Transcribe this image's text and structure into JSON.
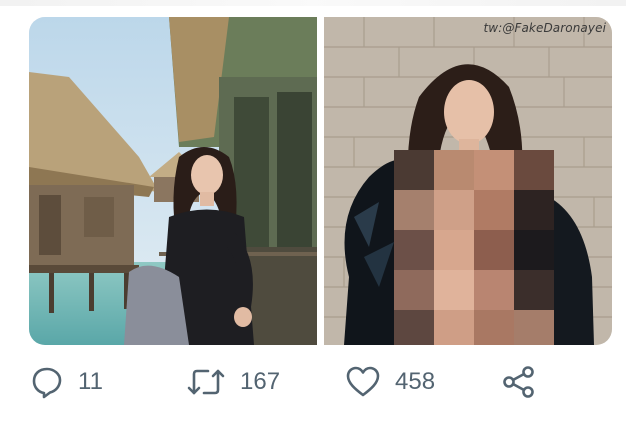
{
  "media": {
    "watermark": "tw:@FakeDaronayei"
  },
  "actions": {
    "reply": {
      "icon": "reply-icon",
      "count": "11"
    },
    "retweet": {
      "icon": "retweet-icon",
      "count": "167"
    },
    "like": {
      "icon": "heart-icon",
      "count": "458"
    },
    "share": {
      "icon": "share-icon"
    }
  },
  "colors": {
    "icon_gray": "#536471",
    "background": "#ffffff"
  }
}
